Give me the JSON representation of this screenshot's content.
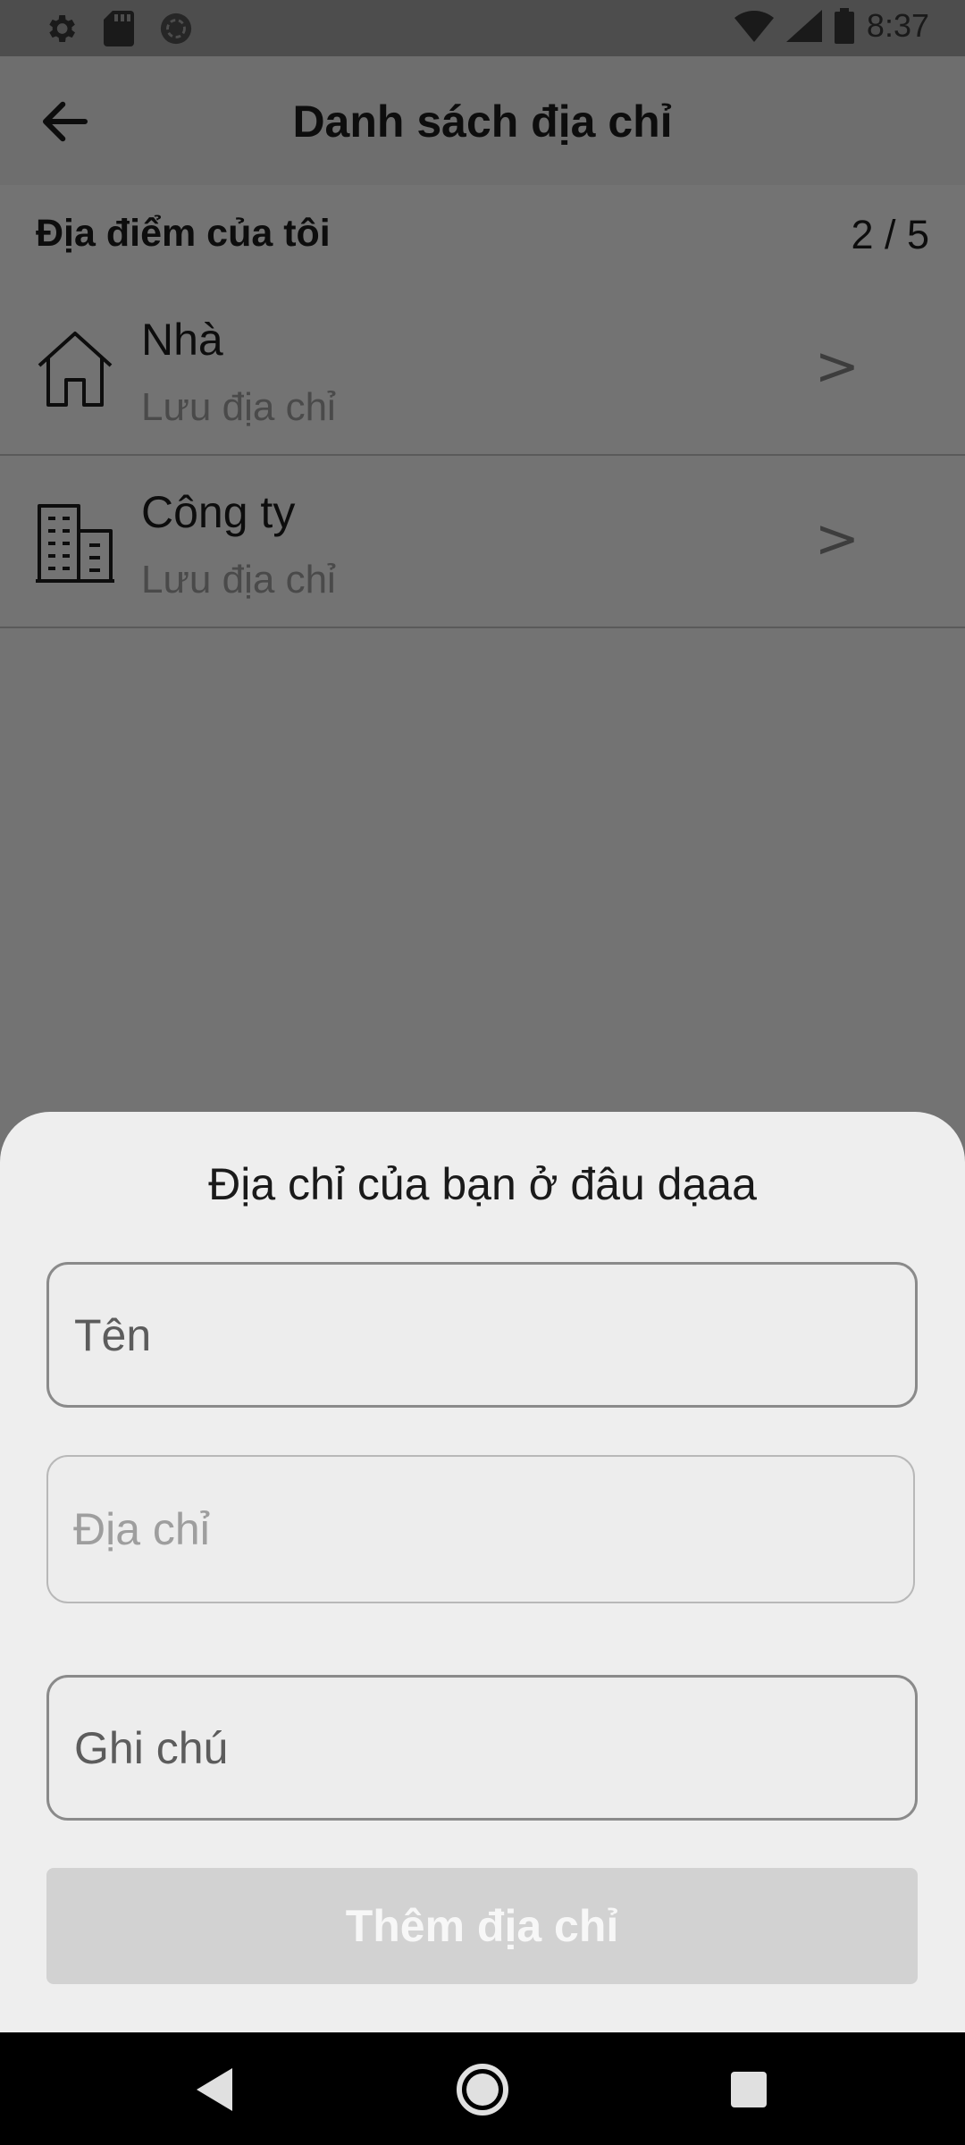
{
  "status_bar": {
    "time": "8:37",
    "left_icons": [
      "settings-icon",
      "sd-card-icon",
      "sync-icon"
    ],
    "right_icons": [
      "wifi-icon",
      "signal-icon",
      "battery-icon"
    ]
  },
  "header": {
    "title": "Danh sách địa chỉ",
    "back_icon": "arrow-left-icon"
  },
  "section": {
    "title": "Địa điểm của tôi",
    "count": "2 / 5"
  },
  "addresses": [
    {
      "name": "Nhà",
      "subtitle": "Lưu địa chỉ",
      "icon": "home-icon",
      "chevron": ">"
    },
    {
      "name": "Công ty",
      "subtitle": "Lưu địa chỉ",
      "icon": "building-icon",
      "chevron": ">"
    }
  ],
  "sheet": {
    "title": "Địa chỉ của bạn ở đâu dạaa",
    "name_field": {
      "placeholder": "Tên",
      "value": ""
    },
    "address_field": {
      "placeholder": "Địa chỉ",
      "value": ""
    },
    "note_field": {
      "placeholder": "Ghi chú",
      "value": ""
    },
    "submit_label": "Thêm địa chỉ"
  },
  "colors": {
    "scrim": "#737373",
    "sheet_bg": "#eeeeee",
    "button_disabled": "#d2d2d2"
  }
}
